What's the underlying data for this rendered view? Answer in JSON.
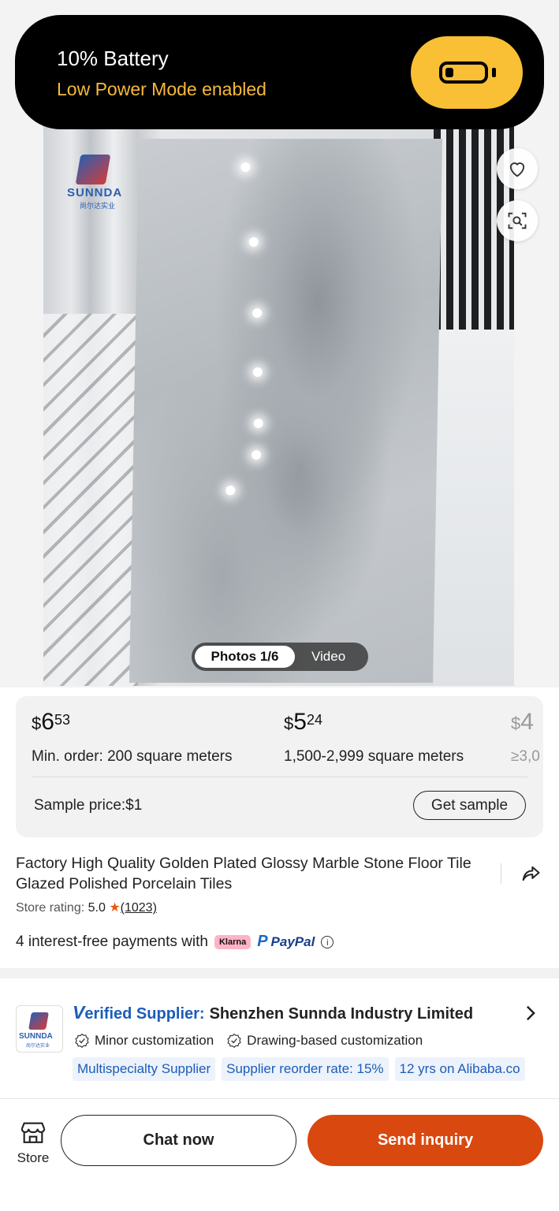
{
  "power_banner": {
    "title": "10% Battery",
    "subtitle": "Low Power Mode enabled",
    "accent_color": "#f9bf35",
    "icon": "battery-low-icon"
  },
  "gallery": {
    "logo_text": "SUNNDA",
    "logo_subtext": "尚尔达实业",
    "photos_label": "Photos 1/6",
    "video_label": "Video"
  },
  "pricing": {
    "tiers": [
      {
        "currency": "$",
        "whole": "6",
        "cents": "53",
        "qty": "Min. order: 200 square meters"
      },
      {
        "currency": "$",
        "whole": "5",
        "cents": "24",
        "qty": "1,500-2,999 square meters"
      },
      {
        "currency": "$",
        "whole": "4",
        "cents": "",
        "qty": "≥3,0"
      }
    ],
    "sample_label": "Sample price:$1",
    "sample_button": "Get sample"
  },
  "product": {
    "title": "Factory High Quality Golden Plated Glossy Marble Stone Floor Tile Glazed Polished Porcelain Tiles",
    "rating_label": "Store rating: ",
    "rating_value": "5.0",
    "rating_star": "★",
    "rating_count": "(1023)"
  },
  "payments": {
    "text": "4 interest-free payments with",
    "klarna": "Klarna",
    "paypal": "PayPal",
    "info": "i"
  },
  "supplier": {
    "verified_v": "V",
    "verified_rest": "erified Supplier:",
    "name": "Shenzhen Sunnda Industry Limited",
    "logo_text": "SUNNDA",
    "logo_subtext": "尚尔达实业",
    "custom_1": "Minor customization",
    "custom_2": "Drawing-based customization",
    "tags": [
      "Multispecialty Supplier",
      "Supplier reorder rate: 15%",
      "12 yrs on Alibaba.co"
    ]
  },
  "bottom_bar": {
    "store_label": "Store",
    "chat_button": "Chat now",
    "inquiry_button": "Send inquiry",
    "inquiry_color": "#d9480f"
  }
}
